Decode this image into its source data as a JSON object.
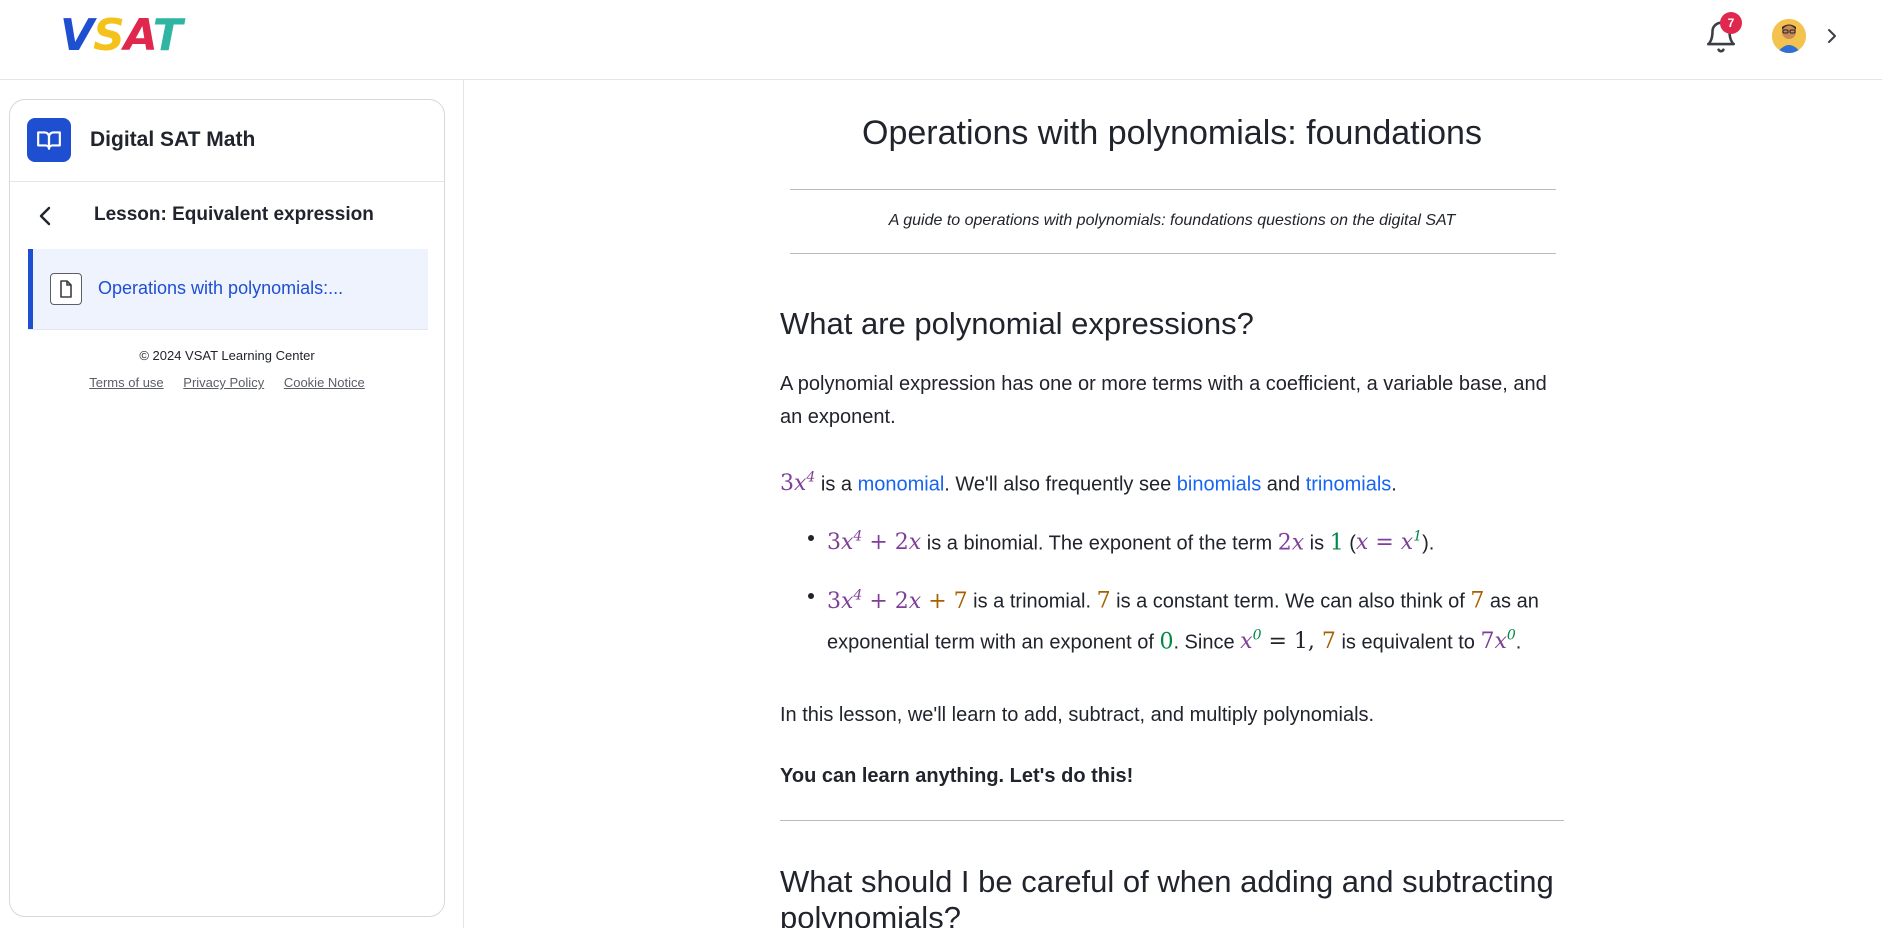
{
  "header": {
    "logo_text": [
      "V",
      "S",
      "A",
      "T"
    ],
    "notification_count": "7",
    "icons": [
      "bell-icon",
      "avatar",
      "chevron-right-icon"
    ]
  },
  "sidebar": {
    "course_title": "Digital SAT Math",
    "course_icon": "book-icon",
    "lesson_title": "Lesson: Equivalent expression",
    "back_icon": "chevron-left-icon",
    "items": [
      {
        "label": "Operations with polynomials:...",
        "icon": "document-icon",
        "selected": true
      }
    ],
    "copyright": "© 2024 VSAT Learning Center",
    "footer_links": [
      "Terms of use",
      "Privacy Policy",
      "Cookie Notice"
    ]
  },
  "article": {
    "title": "Operations with polynomials: foundations",
    "subtitle": "A guide to operations with polynomials: foundations questions on the digital SAT",
    "section1_heading": "What are polynomial expressions?",
    "intro": "A polynomial expression has one or more terms with a coefficient, a variable base, and an exponent.",
    "monomial_line": {
      "t1": " is a ",
      "link_monomial": "monomial",
      "t2": ". We'll also frequently see ",
      "link_binomials": "binomials",
      "t3": " and ",
      "link_trinomials": "trinomials",
      "t4": "."
    },
    "bullet1": {
      "t1": " is a binomial. The exponent of the term ",
      "t2": " is ",
      "t3": " (",
      "t4": ")."
    },
    "bullet2": {
      "t1": " is a trinomial. ",
      "t2": " is a constant term. We can also think of ",
      "t3": " as an exponential term with an exponent of ",
      "t4": ". Since ",
      "t5": " is equivalent to ",
      "t6": "."
    },
    "lesson_line": "In this lesson, we'll learn to add, subtract, and multiply polynomials.",
    "motto": "You can learn anything. Let's do this!",
    "section2_heading": "What should I be careful of when adding and subtracting polynomials?"
  },
  "colors": {
    "brand_blue": "#1f4fd1",
    "link_blue": "#1865f2",
    "math_purple": "#7f3f98",
    "math_gold": "#a76000",
    "math_teal": "#01874a",
    "badge_red": "#e0284f"
  }
}
